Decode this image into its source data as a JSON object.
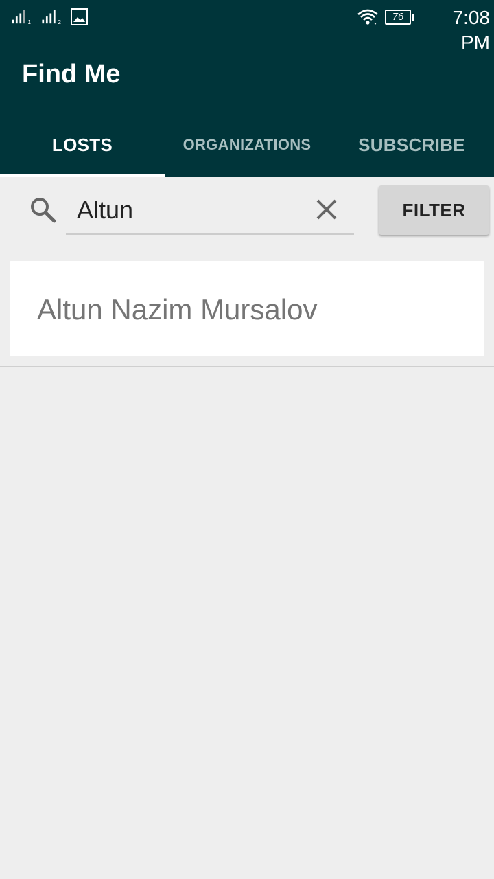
{
  "status_bar": {
    "sim1": "1",
    "sim2": "2",
    "battery": "76",
    "time": "7:08 PM",
    "icons": [
      "signal-icon",
      "signal-icon",
      "gallery-icon",
      "wifi-icon",
      "battery-icon"
    ]
  },
  "app_bar": {
    "title": "Find Me",
    "tabs": [
      {
        "label": "LOSTS",
        "selected": true
      },
      {
        "label": "ORGANIZATIONS",
        "selected": false
      },
      {
        "label": "SUBSCRIBE",
        "selected": false
      }
    ]
  },
  "search": {
    "value": "Altun",
    "filter_label": "FILTER"
  },
  "results": [
    {
      "name": "Altun Nazim Mursalov"
    }
  ],
  "colors": {
    "app_bar": "#00353a",
    "background": "#eeeeee",
    "tab_inactive": "#a8bfc0",
    "filter_button": "#d6d6d6"
  }
}
